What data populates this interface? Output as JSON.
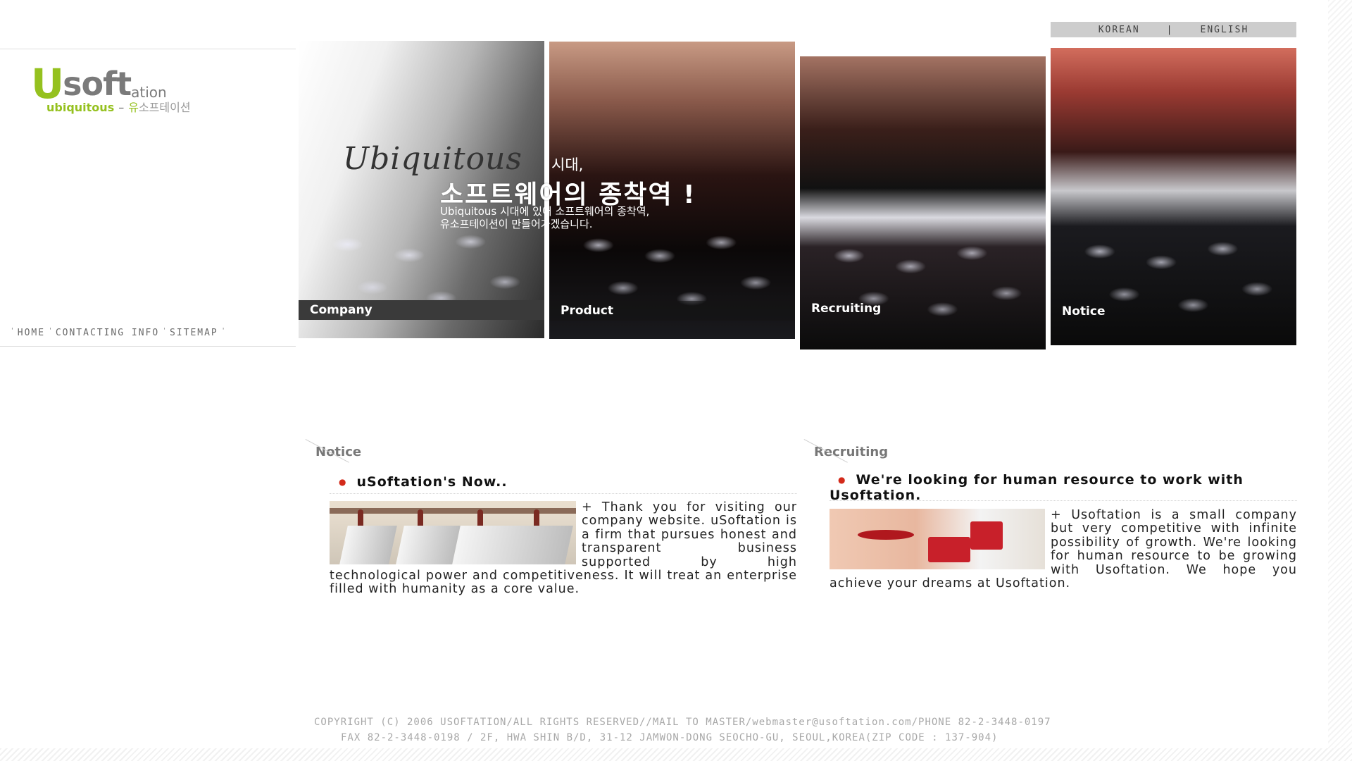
{
  "logo": {
    "u": "U",
    "soft": "soft",
    "ation": "ation",
    "sub_en": "ubiquitous",
    "dash": "–",
    "sub_ko_green": "유",
    "sub_ko_gray": "소프테이션"
  },
  "left_nav": {
    "items": [
      "HOME",
      "CONTACTING INFO",
      "SITEMAP"
    ],
    "separator": "'"
  },
  "language": {
    "korean": "KOREAN",
    "separator": "|",
    "english": "ENGLISH"
  },
  "hero": {
    "script": "Ubiquitous",
    "era": "시대,",
    "title": "소프트웨어의 종착역 !",
    "desc_line1": "Ubiquitous 시대에 있어 소프트웨어의 종착역,",
    "desc_line2": "유소프테이션이 만들어가겠습니다."
  },
  "panels": [
    "Company",
    "Product",
    "Recruiting",
    "Notice"
  ],
  "notice": {
    "heading": "Notice",
    "title": "uSoftation's Now..",
    "body": "+ Thank you for visiting our company website. uSoftation is a firm that pursues honest and transparent business supported by high technological power and competitiveness. It will treat an enterprise filled with humanity as a core value."
  },
  "recruiting": {
    "heading": "Recruiting",
    "title": "We're looking for human resource to work with Usoftation.",
    "body": "+ Usoftation is a small company but very competitive with infinite possibility of growth. We're looking for human resource to be growing with Usoftation. We hope you achieve your dreams at Usoftation."
  },
  "footer": {
    "line1": "COPYRIGHT (C) 2006 USOFTATION/ALL RIGHTS RESERVED//MAIL TO MASTER/webmaster@usoftation.com/PHONE 82-2-3448-0197",
    "line2": "FAX 82-2-3448-0198 / 2F, HWA SHIN B/D, 31-12 JAMWON-DONG SEOCHO-GU, SEOUL,KOREA(ZIP CODE : 137-904)"
  }
}
